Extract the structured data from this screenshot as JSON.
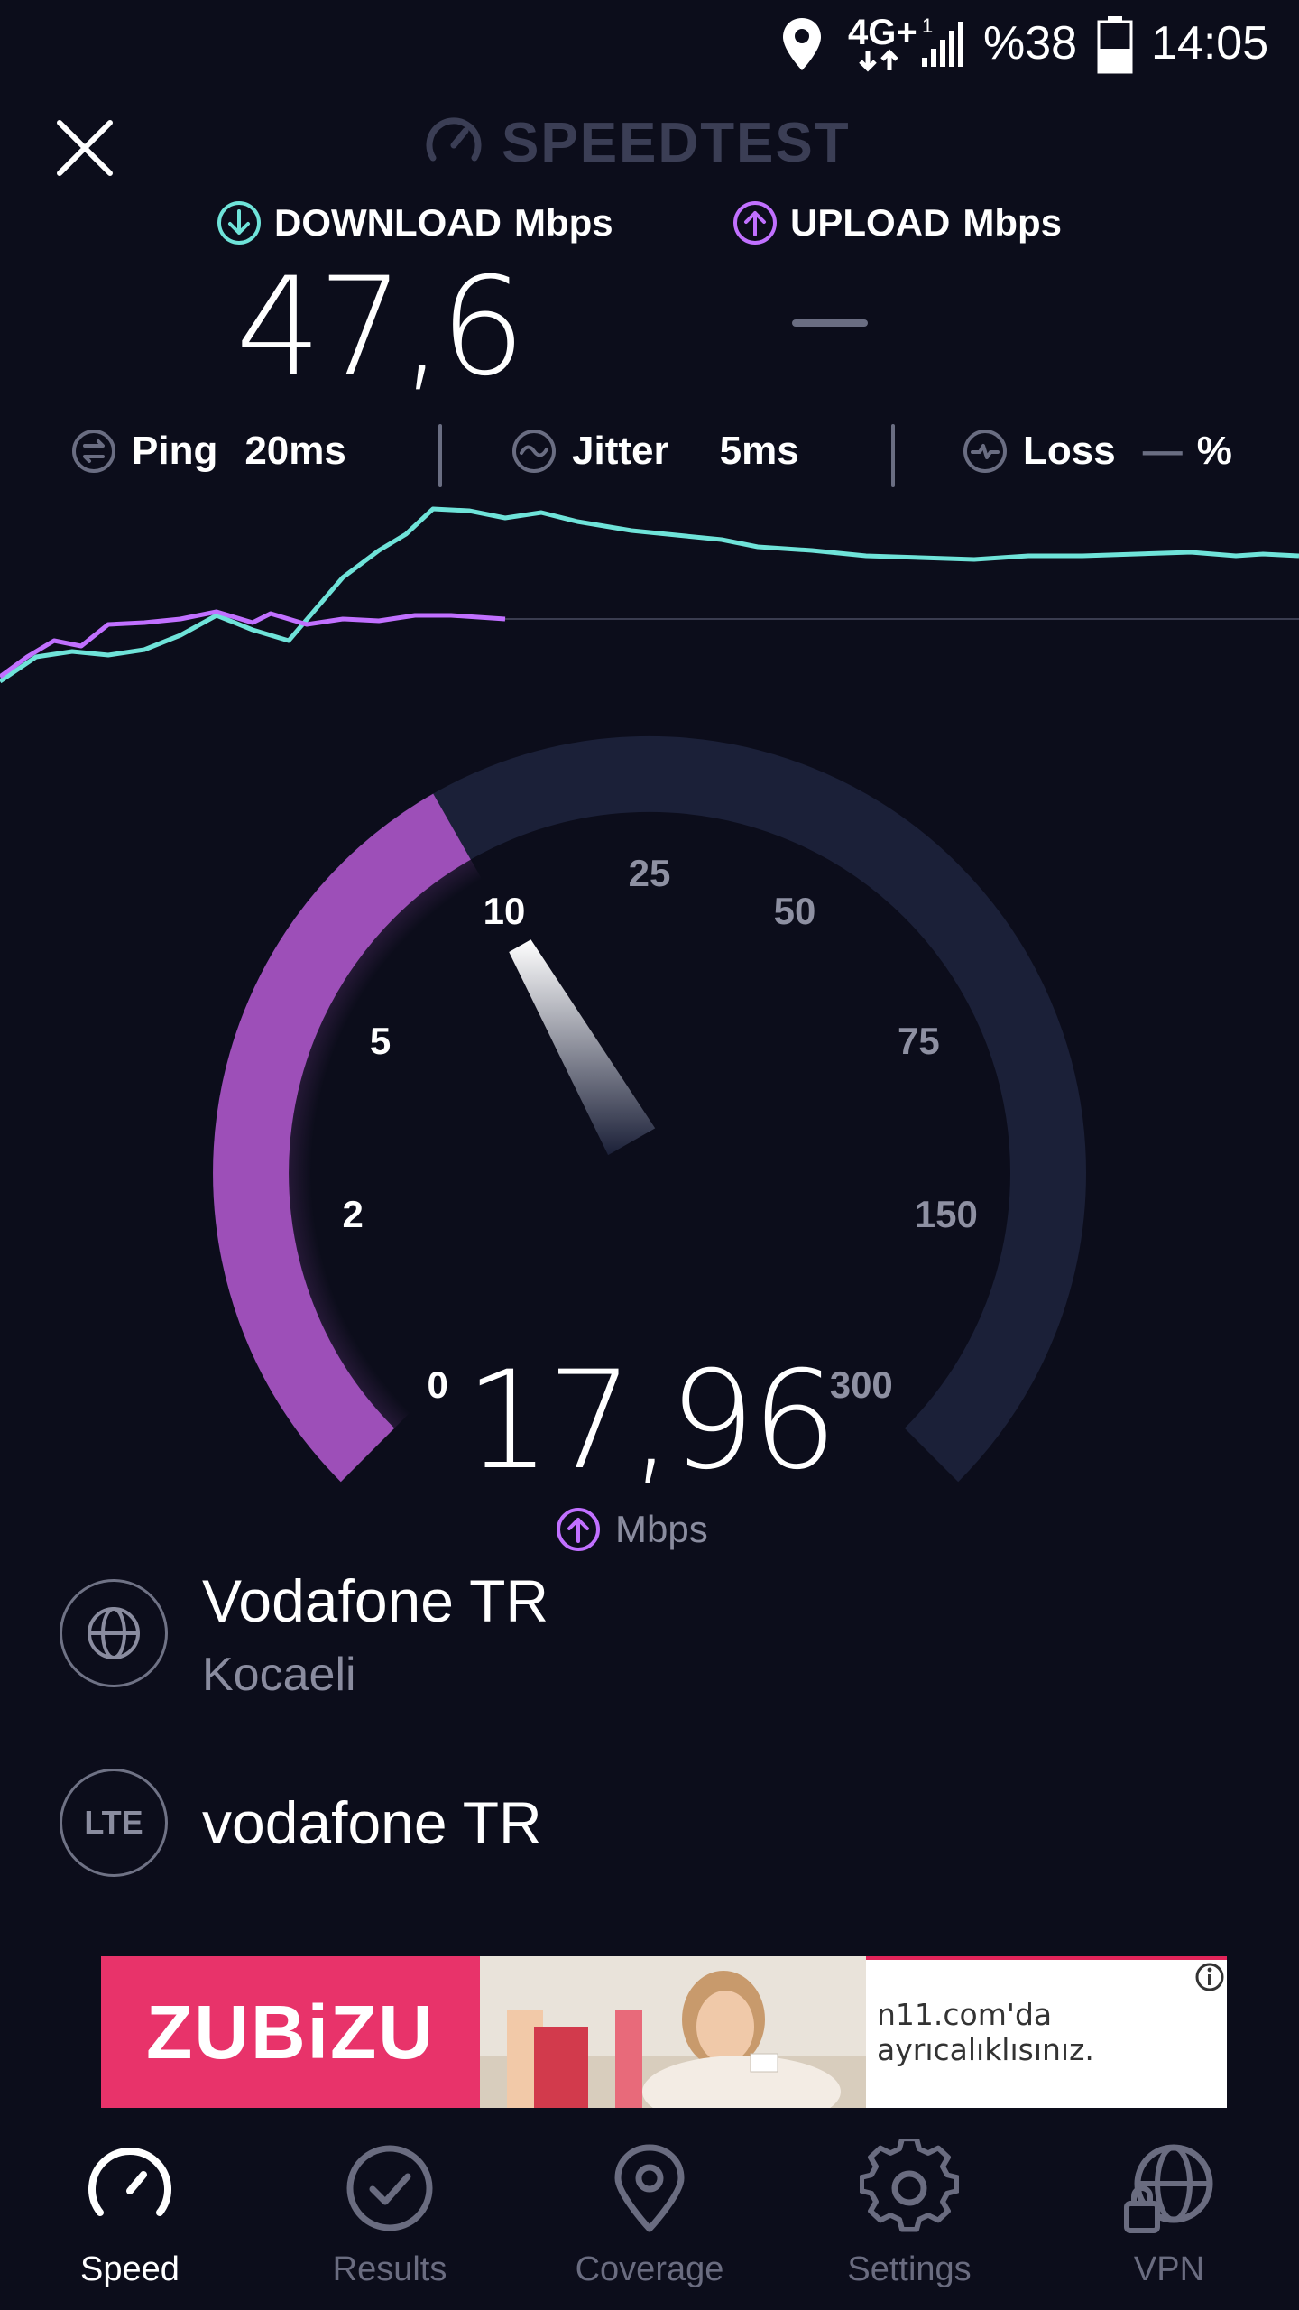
{
  "status_bar": {
    "network": "4G+",
    "sim_index": "1",
    "battery": "%38",
    "time": "14:05"
  },
  "header": {
    "title": "SPEEDTEST",
    "close_icon": "close-icon",
    "logo_icon": "speedometer-icon"
  },
  "results": {
    "download": {
      "label": "DOWNLOAD",
      "unit": "Mbps",
      "value": "47,6",
      "icon": "arrow-down-circle-icon"
    },
    "upload": {
      "label": "UPLOAD",
      "unit": "Mbps",
      "value": "—",
      "icon": "arrow-up-circle-icon"
    }
  },
  "metrics": {
    "ping": {
      "label": "Ping",
      "value": "20ms",
      "icon": "ping-icon"
    },
    "jitter": {
      "label": "Jitter",
      "value": "5ms",
      "icon": "jitter-icon"
    },
    "loss": {
      "label": "Loss",
      "value": "—",
      "unit": "%",
      "icon": "loss-icon"
    }
  },
  "gauge": {
    "ticks": [
      "0",
      "2",
      "5",
      "10",
      "25",
      "50",
      "75",
      "150",
      "300"
    ],
    "reading": "17,96",
    "unit": "Mbps",
    "fraction": 0.39
  },
  "server": {
    "isp": "Vodafone TR",
    "location": "Kocaeli",
    "connection_badge": "LTE",
    "carrier": "vodafone TR",
    "isp_icon": "globe-icon"
  },
  "ad": {
    "brand": "ZUBiZU",
    "text": "n11.com'da ayrıcalıklısınız.",
    "info_icon": "info-icon"
  },
  "nav": {
    "items": [
      {
        "label": "Speed",
        "icon": "speedometer-icon",
        "active": true
      },
      {
        "label": "Results",
        "icon": "check-circle-icon",
        "active": false
      },
      {
        "label": "Coverage",
        "icon": "map-pin-icon",
        "active": false
      },
      {
        "label": "Settings",
        "icon": "gear-icon",
        "active": false
      },
      {
        "label": "VPN",
        "icon": "vpn-globe-lock-icon",
        "active": false
      }
    ]
  },
  "colors": {
    "background": "#0c0d1b",
    "download": "#6fe3d9",
    "upload": "#c170ff",
    "gauge_fill": "#9d4fb8",
    "gauge_track": "#1b2038"
  }
}
